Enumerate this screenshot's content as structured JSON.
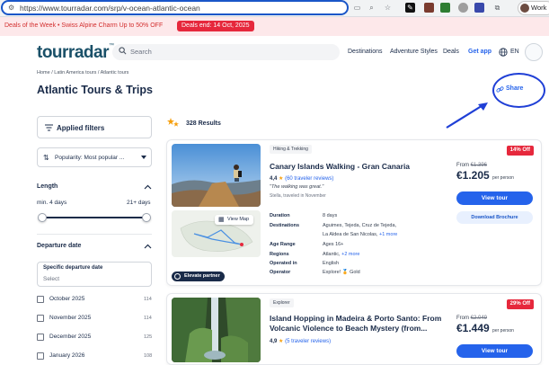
{
  "browser": {
    "url": "https://www.tourradar.com/srp/v-ocean-atlantic-ocean",
    "profile_label": "Work"
  },
  "deals_banner": {
    "text": "Deals of the Week • Swiss Alpine Charm Up to 50% OFF",
    "badge": "Deals end: 14 Oct, 2025"
  },
  "header": {
    "logo": "tourradar",
    "search_placeholder": "Search",
    "nav": [
      "Destinations",
      "Adventure Styles",
      "Deals"
    ],
    "get_app": "Get app",
    "language": "EN"
  },
  "breadcrumb": "Home / Latin America tours / Atlantic tours",
  "page_title": "Atlantic Tours & Trips",
  "share_label": "Share",
  "filters": {
    "applied_label": "Applied filters",
    "sort_label": "Popularity: Most popular ...",
    "length": {
      "title": "Length",
      "min_label": "min. 4 days",
      "max_label": "21+ days",
      "min_value": 4,
      "max_value": 21
    },
    "departure": {
      "title": "Departure date",
      "specific_label": "Specific departure date",
      "select_placeholder": "Select",
      "months": [
        {
          "label": "October 2025",
          "count": "114"
        },
        {
          "label": "November 2025",
          "count": "114"
        },
        {
          "label": "December 2025",
          "count": "125"
        },
        {
          "label": "January 2026",
          "count": "108"
        }
      ]
    }
  },
  "results": {
    "count_label": "328 Results"
  },
  "tours": [
    {
      "tag": "Hiking & Trekking",
      "title": "Canary Islands Walking - Gran Canaria",
      "rating": "4,4",
      "reviews": "(60 traveler reviews)",
      "quote": "\"The walking was great.\"",
      "quote_by": "Stella, traveled in November",
      "view_map": "View Map",
      "partner": "Elevate partner",
      "details": [
        {
          "label": "Duration",
          "value": "8 days",
          "more": ""
        },
        {
          "label": "Destinations",
          "value": "Aguimes, Tejeda, Cruz de Tejeda,",
          "more": ""
        },
        {
          "label": "",
          "value": "La Aldea de San Nicolas,",
          "more": "+1 more"
        },
        {
          "label": "Age Range",
          "value": "Ages 16+",
          "more": ""
        },
        {
          "label": "Regions",
          "value": "Atlantic,",
          "more": "+2 more"
        },
        {
          "label": "Operated in",
          "value": "English",
          "more": ""
        },
        {
          "label": "Operator",
          "value": "Explore! 🏅 Gold",
          "more": ""
        }
      ],
      "discount": "14% Off",
      "from_label": "From",
      "old_price": "€1.396",
      "price": "€1.205",
      "per_person": "per person",
      "view_tour": "View tour",
      "brochure": "Download Brochure",
      "accent": "#e6283c"
    },
    {
      "tag": "Explorer",
      "title": "Island Hopping in Madeira & Porto Santo: From Volcanic Violence to Beach Mystery (from...",
      "rating": "4,9",
      "reviews": "(5 traveler reviews)",
      "discount": "29% Off",
      "from_label": "From",
      "old_price": "€2.049",
      "price": "€1.449",
      "per_person": "per person",
      "view_tour": "View tour"
    }
  ],
  "colors": {
    "brand": "#1a5068",
    "primary": "#2563eb",
    "sale": "#e6283c",
    "annotation": "#1f3fd6"
  }
}
